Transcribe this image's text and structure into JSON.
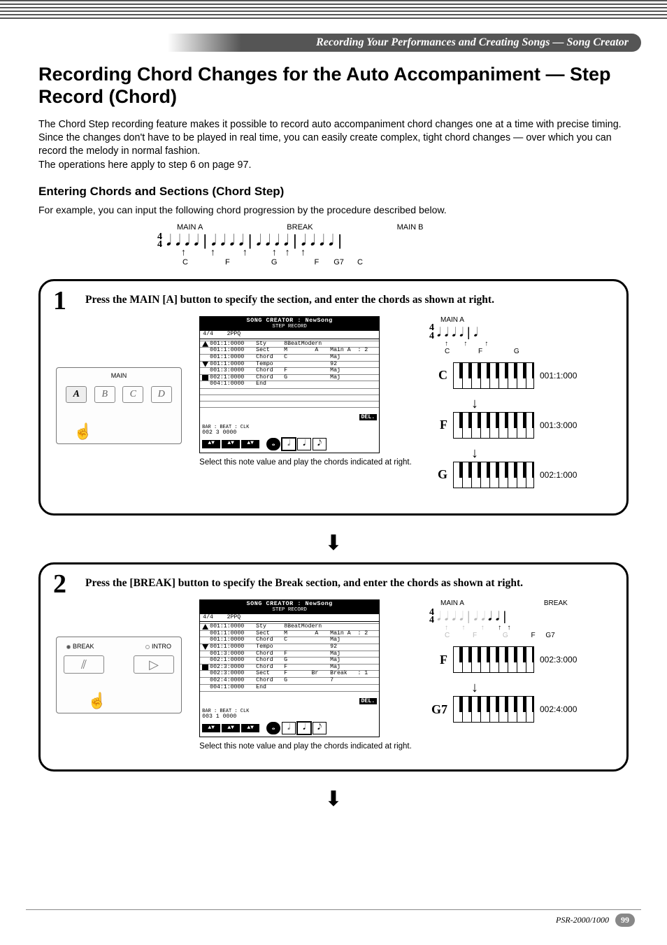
{
  "header": {
    "breadcrumb": "Recording Your Performances and Creating Songs — Song Creator"
  },
  "title": "Recording Chord Changes for the Auto Accompaniment — Step Record (Chord)",
  "intro": "The Chord Step recording feature makes it possible to record auto accompaniment chord changes one at a time with precise timing. Since the changes don't have to be played in real time, you can easily create complex, tight chord changes — over which you can record the melody in normal fashion.\nThe operations here apply to step 6 on page 97.",
  "subtitle": "Entering Chords and Sections (Chord Step)",
  "example_line": "For example, you can input the following chord progression by the procedure described below.",
  "notation": {
    "time_sig_top": "4",
    "time_sig_bot": "4",
    "sections": [
      "MAIN A",
      "BREAK",
      "MAIN B"
    ],
    "chords": [
      "C",
      "F",
      "G",
      "F",
      "G7",
      "C"
    ]
  },
  "steps": [
    {
      "num": "1",
      "instr": "Press the MAIN [A] button to specify the section, and enter the chords as shown at right.",
      "panel": {
        "legend": "MAIN",
        "buttons": [
          "A",
          "B",
          "C",
          "D"
        ],
        "active": 0
      },
      "lcd": {
        "title": "SONG CREATOR : NewSong",
        "subtitle": "STEP RECORD",
        "time_ppq": [
          "4/4",
          "2PPQ"
        ],
        "rows": [
          {
            "t": "001:1:0000",
            "k": "Sty",
            "v1": "8BeatModern",
            "v2": "",
            "caret": "up"
          },
          {
            "t": "001:1:0000",
            "k": "Sect",
            "v1": "M        A",
            "v2": "Main A  : 2"
          },
          {
            "t": "001:1:0000",
            "k": "Chord",
            "v1": "C",
            "v2": "Maj"
          },
          {
            "t": "001:1:0000",
            "k": "Tempo",
            "v1": "",
            "v2": "92",
            "caret": "dn"
          },
          {
            "t": "001:3:0000",
            "k": "Chord",
            "v1": "F",
            "v2": "Maj"
          },
          {
            "t": "002:1:0000",
            "k": "Chord",
            "v1": "G",
            "v2": "Maj",
            "caret": "cur"
          },
          {
            "t": "004:1:0000",
            "k": "End",
            "v1": "",
            "v2": ""
          }
        ],
        "del": "DEL.",
        "bar_lbl": "BAR : BEAT :  CLK",
        "bar_val": "002     3    0000",
        "note_values": [
          "𝅝",
          "𝅗𝅥",
          "𝅘𝅥",
          "𝅘𝅥𝅮"
        ],
        "caption": "Select this note value and play the chords indicated at right."
      },
      "right": {
        "toplabel": "MAIN A",
        "mini_ts_top": "4",
        "mini_ts_bot": "4",
        "mini_chords": [
          "C",
          "F",
          "G"
        ],
        "items": [
          {
            "chord": "C",
            "pos": "001:1:000"
          },
          {
            "chord": "F",
            "pos": "001:3:000"
          },
          {
            "chord": "G",
            "pos": "002:1:000"
          }
        ]
      }
    },
    {
      "num": "2",
      "instr": "Press the [BREAK] button to specify the Break section, and enter the chords as shown at right.",
      "panel2": {
        "labels": [
          "BREAK",
          "INTRO"
        ],
        "active": 0,
        "icons": [
          "⫽",
          "▷"
        ]
      },
      "lcd": {
        "title": "SONG CREATOR : NewSong",
        "subtitle": "STEP RECORD",
        "time_ppq": [
          "4/4",
          "2PPQ"
        ],
        "rows": [
          {
            "t": "001:1:0000",
            "k": "Sty",
            "v1": "8BeatModern",
            "v2": "",
            "caret": "up"
          },
          {
            "t": "001:1:0000",
            "k": "Sect",
            "v1": "M        A",
            "v2": "Main A  : 2"
          },
          {
            "t": "001:1:0000",
            "k": "Chord",
            "v1": "C",
            "v2": "Maj"
          },
          {
            "t": "001:1:0000",
            "k": "Tempo",
            "v1": "",
            "v2": "92",
            "caret": "dn"
          },
          {
            "t": "001:3:0000",
            "k": "Chord",
            "v1": "F",
            "v2": "Maj"
          },
          {
            "t": "002:1:0000",
            "k": "Chord",
            "v1": "G",
            "v2": "Maj"
          },
          {
            "t": "002:3:0000",
            "k": "Chord",
            "v1": "F",
            "v2": "Maj",
            "caret": "cur"
          },
          {
            "t": "002:3:0000",
            "k": "Sect",
            "v1": "F       Br",
            "v2": "Break   : 1"
          },
          {
            "t": "002:4:0000",
            "k": "Chord",
            "v1": "G",
            "v2": "7"
          },
          {
            "t": "004:1:0000",
            "k": "End",
            "v1": "",
            "v2": ""
          }
        ],
        "del": "DEL.",
        "bar_lbl": "BAR : BEAT :  CLK",
        "bar_val": "003     1    0000",
        "note_values": [
          "𝅝",
          "𝅗𝅥",
          "𝅘𝅥",
          "𝅘𝅥𝅮"
        ],
        "caption": "Select this note value and play the chords indicated at right."
      },
      "right": {
        "toplabels": [
          "MAIN A",
          "BREAK"
        ],
        "mini_ts_top": "4",
        "mini_ts_bot": "4",
        "mini_chords": [
          "C",
          "F",
          "G",
          "F",
          "G7"
        ],
        "items": [
          {
            "chord": "F",
            "pos": "002:3:000"
          },
          {
            "chord": "G7",
            "pos": "002:4:000"
          }
        ]
      }
    }
  ],
  "footer": {
    "model": "PSR-2000/1000",
    "page": "99"
  }
}
